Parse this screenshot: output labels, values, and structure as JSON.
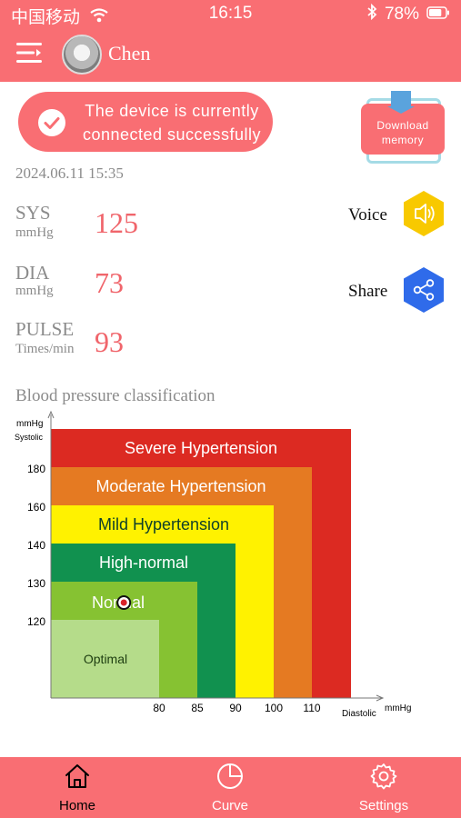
{
  "status_bar": {
    "carrier": "中国移动",
    "time": "16:15",
    "battery": "78%",
    "battery_level": 0.78
  },
  "header": {
    "username": "Chen"
  },
  "connection": {
    "message": "The device is currently connected successfully"
  },
  "download": {
    "label": "Download memory"
  },
  "reading": {
    "datetime": "2024.06.11 15:35",
    "sys": {
      "name": "SYS",
      "unit": "mmHg",
      "value": "125"
    },
    "dia": {
      "name": "DIA",
      "unit": "mmHg",
      "value": "73"
    },
    "pulse": {
      "name": "PULSE",
      "unit": "Times/min",
      "value": "93"
    }
  },
  "actions": {
    "voice": "Voice",
    "share": "Share"
  },
  "classification": {
    "title": "Blood pressure classification"
  },
  "chart_data": {
    "type": "heatmap",
    "title": "Blood pressure classification",
    "ylabel": "mmHg",
    "ylabel_sub": "Systolic",
    "xlabel": "Diastolic",
    "xunit": "mmHg",
    "y_ticks": [
      120,
      130,
      140,
      160,
      180
    ],
    "x_ticks": [
      80,
      85,
      90,
      100,
      110
    ],
    "zones": [
      {
        "name": "Severe Hypertension",
        "color": "#dc2a22"
      },
      {
        "name": "Moderate Hypertension",
        "color": "#e57a22"
      },
      {
        "name": "Mild Hypertension",
        "color": "#fff200"
      },
      {
        "name": "High-normal",
        "color": "#11914f"
      },
      {
        "name": "Normal",
        "color": "#86c232"
      },
      {
        "name": "Optimal",
        "color": "#b5dc8a"
      }
    ],
    "point": {
      "systolic": 125,
      "diastolic": 73
    }
  },
  "tabbar": {
    "items": [
      {
        "label": "Home",
        "icon": "home-icon",
        "active": true
      },
      {
        "label": "Curve",
        "icon": "pie-chart-icon",
        "active": false
      },
      {
        "label": "Settings",
        "icon": "gear-icon",
        "active": false
      }
    ]
  }
}
